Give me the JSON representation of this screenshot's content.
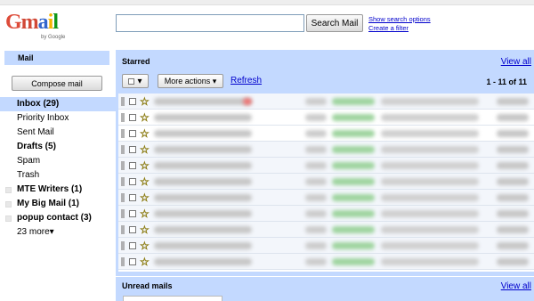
{
  "header": {
    "logo_text": "Gmail",
    "logo_byline": "by Google",
    "search_button": "Search Mail",
    "search_value": "",
    "links": [
      "Show search options",
      "Create a filter"
    ]
  },
  "nav": {
    "mail_label": "Mail",
    "compose_label": "Compose mail",
    "items": [
      {
        "label": "Inbox (29)",
        "style": "active"
      },
      {
        "label": "Priority Inbox",
        "style": "normal"
      },
      {
        "label": "Sent Mail",
        "style": "normal"
      },
      {
        "label": "Drafts (5)",
        "style": "bold"
      },
      {
        "label": "Spam",
        "style": "normal"
      },
      {
        "label": "Trash",
        "style": "normal"
      },
      {
        "label": "MTE Writers (1)",
        "style": "bold",
        "label_swatch": true
      },
      {
        "label": "My Big Mail (1)",
        "style": "bold",
        "label_swatch": true
      },
      {
        "label": "popup contact (3)",
        "style": "bold",
        "label_swatch": true
      },
      {
        "label": "23 more▾",
        "style": "normal"
      }
    ]
  },
  "starred": {
    "title": "Starred",
    "view_all": "View all",
    "more_actions": "More actions ▾",
    "refresh": "Refresh",
    "count": "1 - 11 of 11",
    "checkbox_menu_arrow": "▾",
    "row_count": 11
  },
  "unread": {
    "title": "Unread mails",
    "view_all": "View all"
  },
  "colors": {
    "panel": "#c3d9ff",
    "link": "#0000cc",
    "star": "#f4e34a"
  }
}
